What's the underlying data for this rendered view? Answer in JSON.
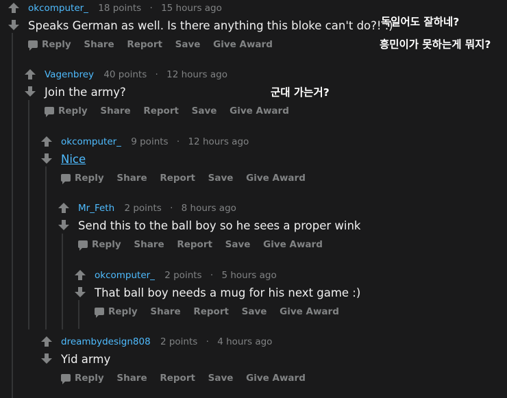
{
  "actions": {
    "reply": "Reply",
    "share": "Share",
    "report": "Report",
    "save": "Save",
    "award": "Give Award"
  },
  "comments": [
    {
      "author": "okcomputer_",
      "points": "18 points",
      "time": "15 hours ago",
      "body": "Speaks German as well. Is there anything this bloke can't do?! :)"
    },
    {
      "author": "Vagenbrey",
      "points": "40 points",
      "time": "12 hours ago",
      "body": "Join the army?"
    },
    {
      "author": "okcomputer_",
      "points": "9 points",
      "time": "12 hours ago",
      "body": "Nice"
    },
    {
      "author": "Mr_Feth",
      "points": "2 points",
      "time": "8 hours ago",
      "body": "Send this to the ball boy so he sees a proper wink"
    },
    {
      "author": "okcomputer_",
      "points": "2 points",
      "time": "5 hours ago",
      "body": "That ball boy needs a mug for his next game :)"
    },
    {
      "author": "dreambydesign808",
      "points": "2 points",
      "time": "4 hours ago",
      "body": "Yid army"
    }
  ],
  "annotations": {
    "line1": "독일어도 잘하네?",
    "line2": "흥민이가 못하는게 뭐지?",
    "line3": "군대 가는거?"
  }
}
